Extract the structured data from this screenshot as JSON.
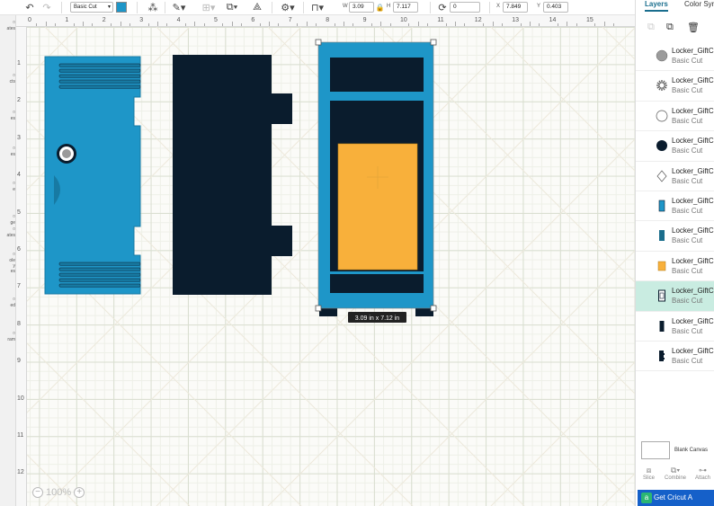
{
  "toolbar": {
    "operation_value": "Basic Cut",
    "swatch_color": "#1e96c8",
    "size": {
      "w_label": "W",
      "w_value": "3.09",
      "h_label": "H",
      "h_value": "7.117"
    },
    "rotate_value": "0",
    "position": {
      "x_label": "X",
      "x_value": "7.849",
      "y_label": "Y",
      "y_value": "0.403"
    }
  },
  "leftnav": {
    "items": [
      "ates",
      "cts",
      "es",
      "es",
      "e",
      "ge",
      "ates",
      "ole\ny\nes",
      "ed",
      "ram"
    ]
  },
  "rulers": {
    "top": [
      "0",
      "1",
      "2",
      "3",
      "4",
      "5",
      "6",
      "7",
      "8",
      "9",
      "10",
      "11",
      "12",
      "13",
      "14",
      "15"
    ],
    "left": [
      "1",
      "2",
      "3",
      "4",
      "5",
      "6",
      "7",
      "8",
      "9",
      "10",
      "11",
      "12"
    ]
  },
  "canvas": {
    "dimension_tooltip": "3.09  in x 7.12  in",
    "zoom_value": "100%",
    "colors": {
      "locker_blue": "#1e96c8",
      "navy": "#0a1c2d",
      "orange": "#f8b03b"
    }
  },
  "panel": {
    "tabs": [
      "Layers",
      "Color Sync"
    ],
    "layers": [
      {
        "name": "Locker_GiftCard",
        "op": "Basic Cut",
        "thumb": "gray-circle"
      },
      {
        "name": "Locker_GiftCard",
        "op": "Basic Cut",
        "thumb": "gear"
      },
      {
        "name": "Locker_GiftCard",
        "op": "Basic Cut",
        "thumb": "white-circle"
      },
      {
        "name": "Locker_GiftCard",
        "op": "Basic Cut",
        "thumb": "navy-circle"
      },
      {
        "name": "Locker_GiftCard",
        "op": "Basic Cut",
        "thumb": "white-shape"
      },
      {
        "name": "Locker_GiftCard",
        "op": "Basic Cut",
        "thumb": "blue-locker"
      },
      {
        "name": "Locker_GiftCard",
        "op": "Basic Cut",
        "thumb": "teal-locker"
      },
      {
        "name": "Locker_GiftCard",
        "op": "Basic Cut",
        "thumb": "orange-rect"
      },
      {
        "name": "Locker_GiftCard",
        "op": "Basic Cut",
        "thumb": "outline-locker",
        "selected": true
      },
      {
        "name": "Locker_GiftCard",
        "op": "Basic Cut",
        "thumb": "navy-bar"
      },
      {
        "name": "Locker_GiftCard",
        "op": "Basic Cut",
        "thumb": "navy-locker"
      }
    ],
    "blank_canvas_label": "Blank Canvas",
    "bottom_tools": [
      "Slice",
      "Combine",
      "Attach"
    ],
    "promo": "Get Cricut A",
    "promo_badge": "a"
  }
}
